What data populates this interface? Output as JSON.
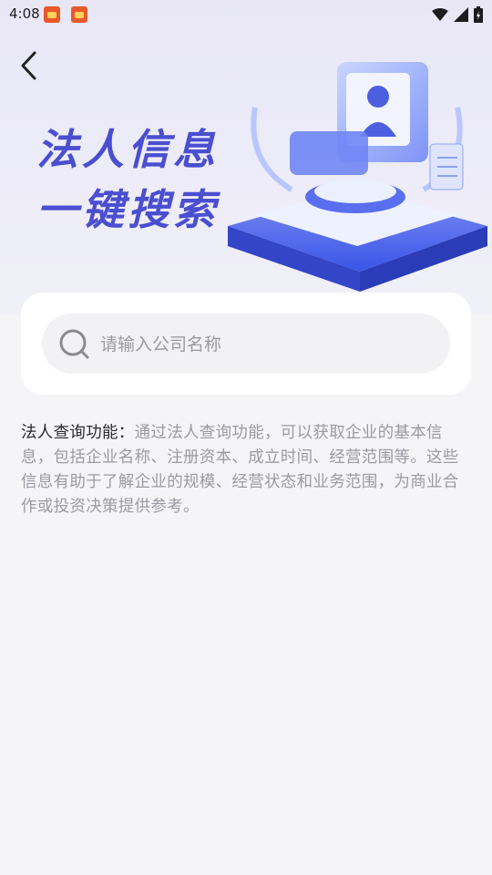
{
  "status_bar": {
    "time": "4:08",
    "notification_icons": [
      "app-notification-icon",
      "app-notification-icon"
    ],
    "system_icons": [
      "wifi-icon",
      "signal-icon",
      "battery-charging-icon"
    ]
  },
  "header": {
    "back_icon": "chevron-left-icon"
  },
  "hero": {
    "title_line1": "法人信息",
    "title_line2": "一键搜索",
    "illustration": "id-card-platform-illustration",
    "accent_color": "#4a4ed0"
  },
  "search": {
    "placeholder": "请输入公司名称",
    "value": ""
  },
  "description": {
    "label": "法人查询功能：",
    "text": "通过法人查询功能，可以获取企业的基本信息，包括企业名称、注册资本、成立时间、经营范围等。这些信息有助于了解企业的规模、经营状态和业务范围，为商业合作或投资决策提供参考。"
  }
}
